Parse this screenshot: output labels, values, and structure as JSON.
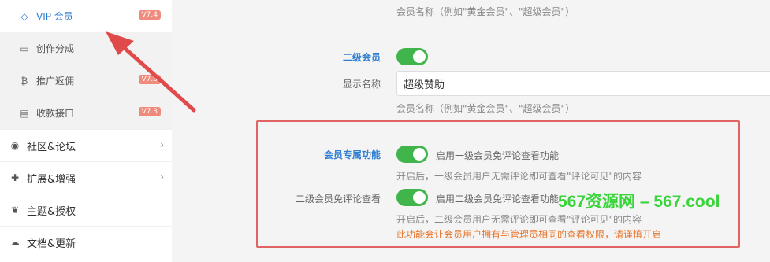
{
  "sidebar": {
    "submenu": [
      {
        "label": "VIP 会员",
        "badge": "V7.4",
        "icon": "gem-icon"
      },
      {
        "label": "创作分成",
        "badge": "",
        "icon": "inbox-icon"
      },
      {
        "label": "推广返佣",
        "badge": "V7.3",
        "icon": "bitcoin-icon"
      },
      {
        "label": "收款接口",
        "badge": "V7.3",
        "icon": "card-icon"
      }
    ],
    "menu": [
      {
        "label": "社区&论坛",
        "icon": "compass-icon"
      },
      {
        "label": "扩展&增强",
        "icon": "puzzle-icon"
      },
      {
        "label": "主题&授权",
        "icon": "leaf-icon"
      },
      {
        "label": "文档&更新",
        "icon": "cloud-icon"
      }
    ]
  },
  "main": {
    "top_hint": "会员名称（例如\"黄金会员\"、\"超级会员\"）",
    "level2": {
      "label": "二级会员",
      "enabled": true,
      "display_name_label": "显示名称",
      "display_name_value": "超级赞助",
      "hint": "会员名称（例如\"黄金会员\"、\"超级会员\"）"
    },
    "exclusive": {
      "label": "会员专属功能",
      "toggle1_text": "启用一级会员免评论查看功能",
      "toggle1_hint": "开启后，一级会员用户无需评论即可查看\"评论可见\"的内容",
      "toggle2_label": "二级会员免评论查看",
      "toggle2_text": "启用二级会员免评论查看功能",
      "toggle2_hint": "开启后，二级会员用户无需评论即可查看\"评论可见\"的内容",
      "warning": "此功能会让会员用户拥有与管理员相同的查看权限，请谨慎开启"
    },
    "watermark": "567资源网 – 567.cool"
  },
  "colors": {
    "accent": "#2f7fd1",
    "toggle_on": "#3fb54c",
    "highlight_box": "#e06464",
    "arrow": "#e04a4a",
    "warning": "#e8742a",
    "watermark": "#38d43a"
  }
}
